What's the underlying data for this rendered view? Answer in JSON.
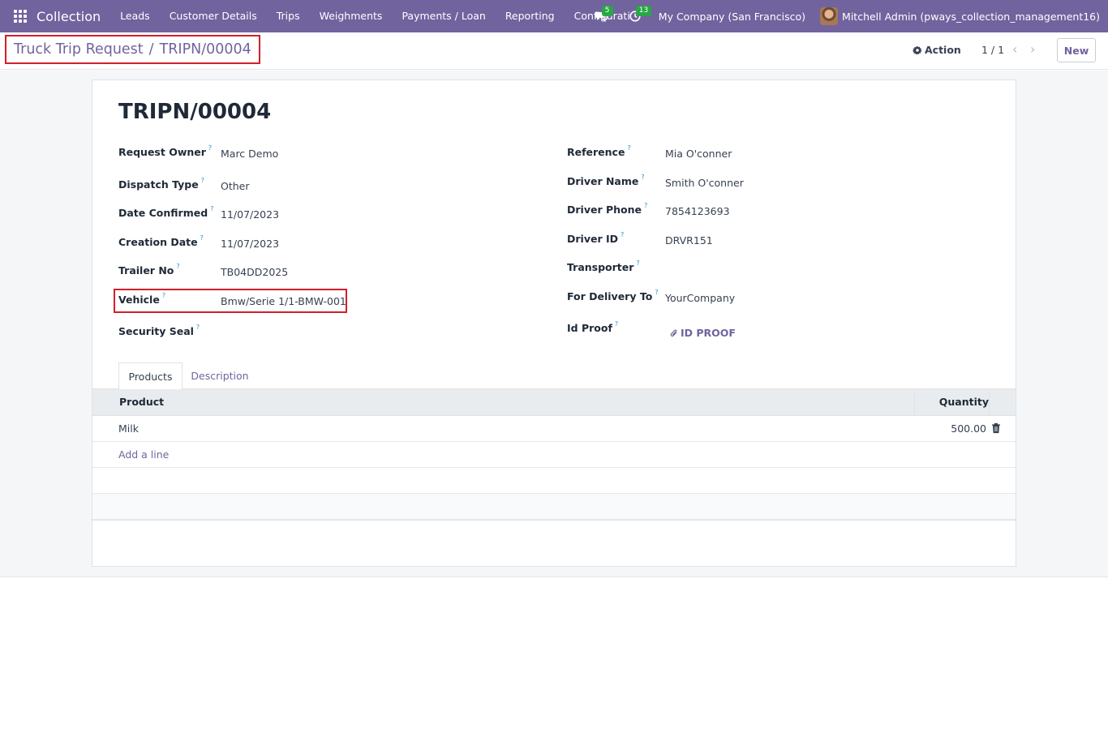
{
  "navbar": {
    "brand": "Collection",
    "menu": [
      "Leads",
      "Customer Details",
      "Trips",
      "Weighments",
      "Payments / Loan",
      "Reporting",
      "Configurati"
    ],
    "messages_badge": "5",
    "activities_badge": "13",
    "company": "My Company (San Francisco)",
    "user": "Mitchell Admin (pways_collection_management16)",
    "background_color": "#71639e"
  },
  "control": {
    "breadcrumb_parent": "Truck Trip Request",
    "breadcrumb_separator": "/",
    "breadcrumb_current": "TRIPN/00004",
    "action_label": "Action",
    "pager": "1 / 1",
    "new_label": "New"
  },
  "form": {
    "title": "TRIPN/00004",
    "help_mark": "?",
    "left": [
      {
        "label": "Request Owner",
        "value": "Marc Demo"
      },
      {
        "label": "Dispatch Type",
        "value": "Other"
      },
      {
        "label": "Date Confirmed",
        "value": "11/07/2023"
      },
      {
        "label": "Creation Date",
        "value": "11/07/2023"
      },
      {
        "label": "Trailer No",
        "value": "TB04DD2025"
      },
      {
        "label": "Vehicle",
        "value": "Bmw/Serie 1/1-BMW-001"
      },
      {
        "label": "Security Seal",
        "value": ""
      }
    ],
    "right": [
      {
        "label": "Reference",
        "value": "Mia O'conner"
      },
      {
        "label": "Driver Name",
        "value": "Smith O'conner"
      },
      {
        "label": "Driver Phone",
        "value": "7854123693"
      },
      {
        "label": "Driver ID",
        "value": "DRVR151"
      },
      {
        "label": "Transporter",
        "value": ""
      },
      {
        "label": "For Delivery To",
        "value": "YourCompany"
      },
      {
        "label": "Id Proof",
        "value": "ID PROOF"
      }
    ]
  },
  "notebook": {
    "tabs": [
      "Products",
      "Description"
    ],
    "columns": [
      "Product",
      "Quantity"
    ],
    "rows": [
      {
        "product": "Milk",
        "quantity": "500.00"
      }
    ],
    "add_line": "Add a line"
  }
}
